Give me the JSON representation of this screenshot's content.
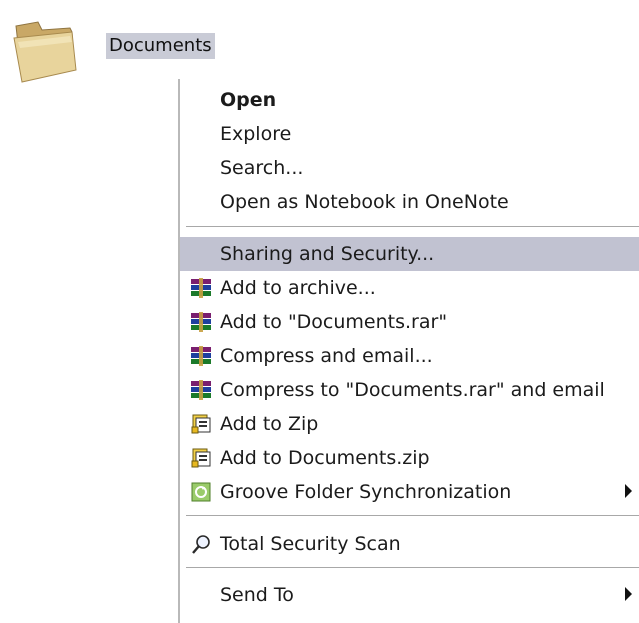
{
  "desktop": {
    "folder": {
      "label": "Documents",
      "icon": "folder-icon"
    }
  },
  "menu": {
    "open": "Open",
    "explore": "Explore",
    "search": "Search...",
    "onenote": "Open as Notebook in OneNote",
    "sharing": "Sharing and Security...",
    "add_archive": "Add to archive...",
    "add_rar": "Add to \"Documents.rar\"",
    "compress_email": "Compress and email...",
    "compress_rar_email": "Compress to \"Documents.rar\" and email",
    "add_zip": "Add to Zip",
    "add_docs_zip": "Add to Documents.zip",
    "groove": "Groove Folder Synchronization",
    "security_scan": "Total Security Scan",
    "send_to": "Send To"
  },
  "colors": {
    "highlight": "#c1c2d1",
    "selection": "#c9cbd6"
  }
}
